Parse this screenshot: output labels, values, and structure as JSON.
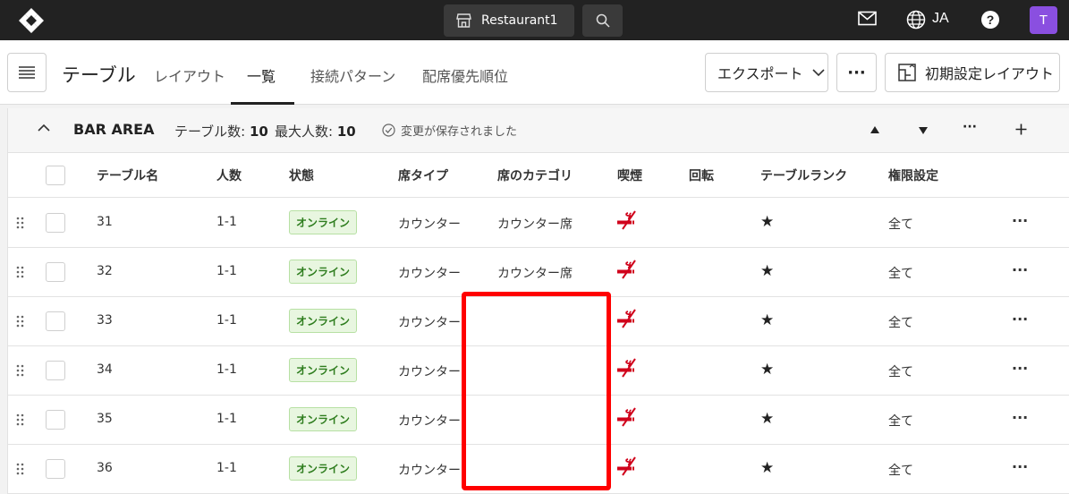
{
  "topbar": {
    "restaurant_label": "Restaurant1",
    "language": "JA",
    "avatar_initial": "T",
    "avatar_color": "#8a4fe0"
  },
  "header": {
    "title": "テーブル",
    "tabs": [
      {
        "label": "レイアウト",
        "active": false
      },
      {
        "label": "一覧",
        "active": true
      },
      {
        "label": "接続パターン",
        "active": false
      },
      {
        "label": "配席優先順位",
        "active": false
      }
    ],
    "export_label": "エクスポート",
    "more_label": "···",
    "layout_label": "初期設定レイアウト"
  },
  "area": {
    "name": "BAR AREA",
    "table_count_label": "テーブル数:",
    "table_count": "10",
    "max_people_label": "最大人数:",
    "max_people": "10",
    "saved_message": "変更が保存されました"
  },
  "columns": [
    "テーブル名",
    "人数",
    "状態",
    "席タイプ",
    "席のカテゴリ",
    "喫煙",
    "回転",
    "テーブルランク",
    "権限設定"
  ],
  "rows": [
    {
      "name": "31",
      "people": "1-1",
      "status": "オンライン",
      "seat_type": "カウンター",
      "category": "カウンター席",
      "rank": "★",
      "permission": "全て"
    },
    {
      "name": "32",
      "people": "1-1",
      "status": "オンライン",
      "seat_type": "カウンター",
      "category": "カウンター席",
      "rank": "★",
      "permission": "全て"
    },
    {
      "name": "33",
      "people": "1-1",
      "status": "オンライン",
      "seat_type": "カウンター",
      "category": "",
      "rank": "★",
      "permission": "全て"
    },
    {
      "name": "34",
      "people": "1-1",
      "status": "オンライン",
      "seat_type": "カウンター",
      "category": "",
      "rank": "★",
      "permission": "全て"
    },
    {
      "name": "35",
      "people": "1-1",
      "status": "オンライン",
      "seat_type": "カウンター",
      "category": "",
      "rank": "★",
      "permission": "全て"
    },
    {
      "name": "36",
      "people": "1-1",
      "status": "オンライン",
      "seat_type": "カウンター",
      "category": "",
      "rank": "★",
      "permission": "全て"
    }
  ],
  "row_more_label": "···",
  "icons": {
    "smoking": "no-smoking-icon",
    "highlight_color": "#ff0000"
  }
}
